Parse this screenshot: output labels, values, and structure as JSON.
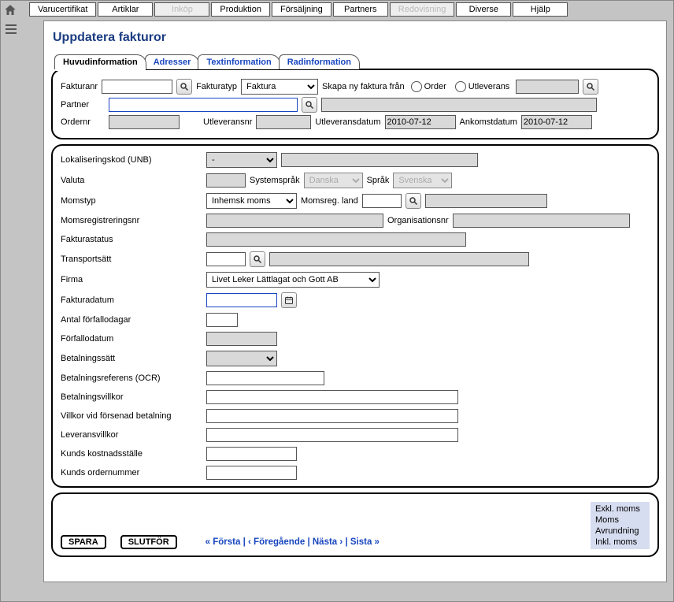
{
  "menu": {
    "varucertifikat": "Varucertifikat",
    "artiklar": "Artiklar",
    "inkop": "Inköp",
    "produktion": "Produktion",
    "forsaljning": "Försäljning",
    "partners": "Partners",
    "redovisning": "Redovisning",
    "diverse": "Diverse",
    "hjalp": "Hjälp"
  },
  "page_title": "Uppdatera fakturor",
  "tabs": {
    "huvud": "Huvudinformation",
    "adresser": "Adresser",
    "textinfo": "Textinformation",
    "radinfo": "Radinformation"
  },
  "top_panel": {
    "fakturanr_lbl": "Fakturanr",
    "fakturanr_val": "",
    "fakturatyp_lbl": "Fakturatyp",
    "fakturatyp_val": "Faktura",
    "skapa_ny_lbl": "Skapa ny faktura från",
    "order_lbl": "Order",
    "utleverans_lbl": "Utleverans",
    "utleverans_val": "",
    "partner_lbl": "Partner",
    "partner_val": "",
    "partner_display": "",
    "ordernr_lbl": "Ordernr",
    "ordernr_val": "",
    "utleveransnr_lbl": "Utleveransnr",
    "utleveransnr_val": "",
    "utleveransdatum_lbl": "Utleveransdatum",
    "utleveransdatum_val": "2010-07-12",
    "ankomstdatum_lbl": "Ankomstdatum",
    "ankomstdatum_val": "2010-07-12"
  },
  "main_panel": {
    "lokaliseringskod_lbl": "Lokaliseringskod (UNB)",
    "lokaliseringskod_val": "-",
    "valuta_lbl": "Valuta",
    "valuta_val": "",
    "systemsprak_lbl": "Systemspråk",
    "systemsprak_val": "Danska",
    "sprak_lbl": "Språk",
    "sprak_val": "Svenska",
    "momstyp_lbl": "Momstyp",
    "momstyp_val": "Inhemsk moms",
    "momsreg_land_lbl": "Momsreg. land",
    "momsreg_land_val": "",
    "momsreg_land_display": "",
    "momsregnr_lbl": "Momsregistreringsnr",
    "momsregnr_val": "",
    "organisationsnr_lbl": "Organisationsnr",
    "organisationsnr_val": "",
    "fakturastatus_lbl": "Fakturastatus",
    "fakturastatus_val": "",
    "transportsatt_lbl": "Transportsätt",
    "transportsatt_val": "",
    "transportsatt_display": "",
    "firma_lbl": "Firma",
    "firma_val": "Livet Leker Lättlagat och Gott AB",
    "fakturadatum_lbl": "Fakturadatum",
    "fakturadatum_val": "",
    "antal_forfallodagar_lbl": "Antal förfallodagar",
    "antal_forfallodagar_val": "",
    "forfallodatum_lbl": "Förfallodatum",
    "forfallodatum_val": "",
    "betalningssatt_lbl": "Betalningssätt",
    "betalningssatt_val": "",
    "betalningsref_lbl": "Betalningsreferens (OCR)",
    "betalningsref_val": "",
    "betalningsvillkor_lbl": "Betalningsvillkor",
    "betalningsvillkor_val": "",
    "villkor_forsenad_lbl": "Villkor vid försenad betalning",
    "villkor_forsenad_val": "",
    "leveransvillkor_lbl": "Leveransvillkor",
    "leveransvillkor_val": "",
    "kunds_kostnad_lbl": "Kunds kostnadsställe",
    "kunds_kostnad_val": "",
    "kunds_ordernr_lbl": "Kunds ordernummer",
    "kunds_ordernr_val": ""
  },
  "footer": {
    "spara": "SPARA",
    "slutfor": "SLUTFÖR",
    "nav_first": "« Första",
    "nav_prev": "‹ Föregående",
    "nav_next": "Nästa ›",
    "nav_last": "Sista »",
    "sep": " | ",
    "exkl_moms": "Exkl. moms",
    "moms": "Moms",
    "avrundning": "Avrundning",
    "inkl_moms": "Inkl. moms"
  }
}
